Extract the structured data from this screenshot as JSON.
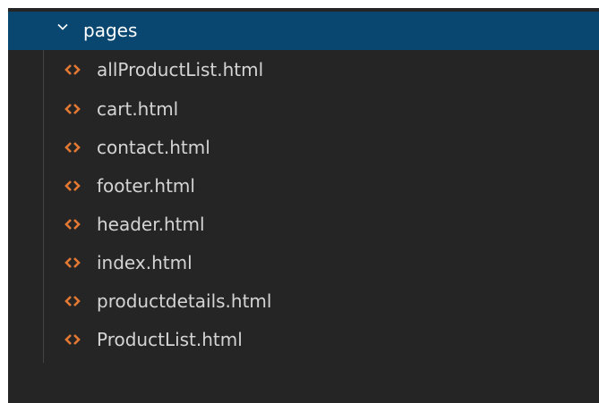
{
  "explorer": {
    "folder": {
      "name": "pages",
      "expanded": true,
      "icon": "chevron-down-icon"
    },
    "files": [
      {
        "name": "allProductList.html",
        "icon": "html-file-icon"
      },
      {
        "name": "cart.html",
        "icon": "html-file-icon"
      },
      {
        "name": "contact.html",
        "icon": "html-file-icon"
      },
      {
        "name": "footer.html",
        "icon": "html-file-icon"
      },
      {
        "name": "header.html",
        "icon": "html-file-icon"
      },
      {
        "name": "index.html",
        "icon": "html-file-icon"
      },
      {
        "name": "productdetails.html",
        "icon": "html-file-icon"
      },
      {
        "name": "ProductList.html",
        "icon": "html-file-icon"
      }
    ],
    "colors": {
      "background": "#252526",
      "selected_row": "#094771",
      "html_icon": "#e37933",
      "text": "#d4d4d4"
    }
  }
}
